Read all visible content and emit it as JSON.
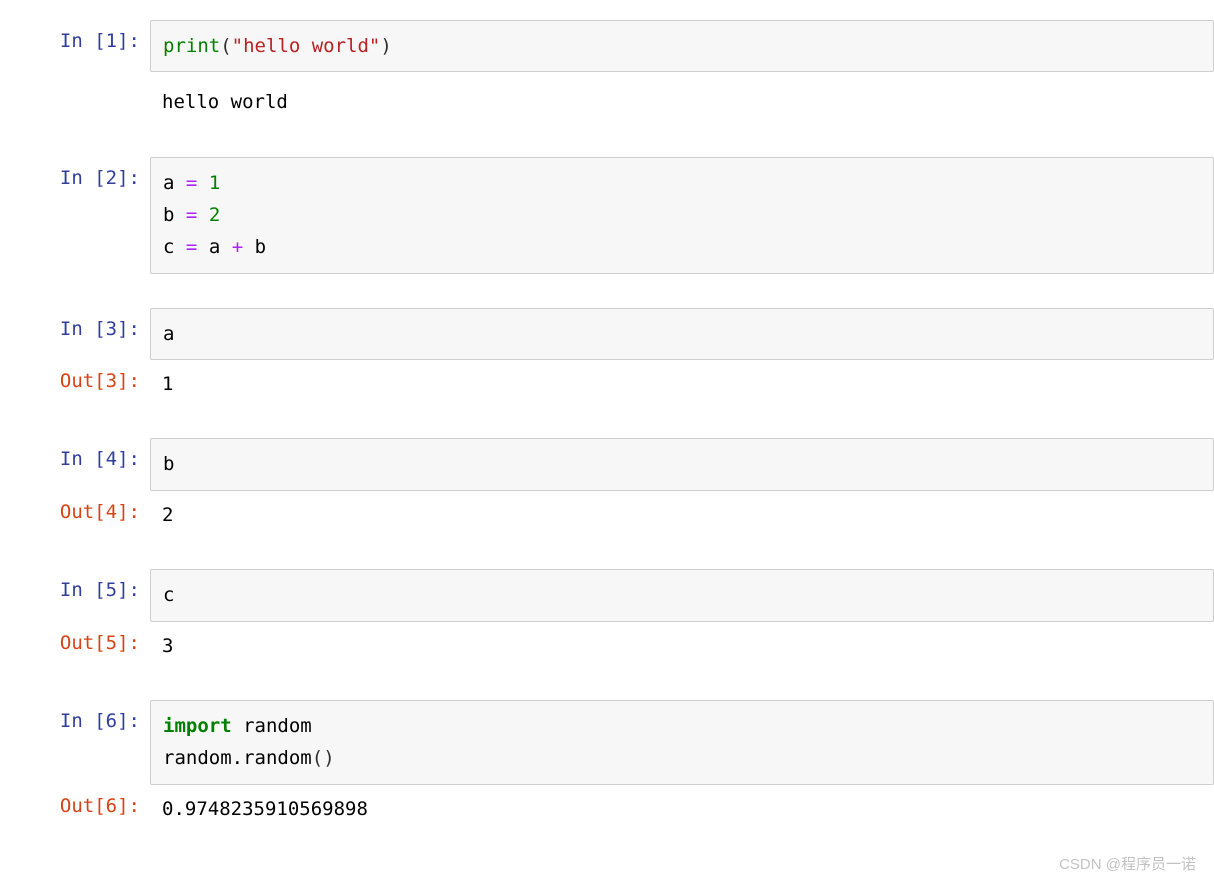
{
  "cells": [
    {
      "in_prompt": "In [1]:",
      "code_html": "<span class=\"tok-builtin\">print</span><span class=\"tok-paren\">(</span><span class=\"tok-string\">\"hello world\"</span><span class=\"tok-paren\">)</span>",
      "stream_output": "hello world"
    },
    {
      "in_prompt": "In [2]:",
      "code_html": "<span class=\"tok-name\">a</span> <span class=\"tok-op\">=</span> <span class=\"tok-num\">1</span>\n<span class=\"tok-name\">b</span> <span class=\"tok-op\">=</span> <span class=\"tok-num\">2</span>\n<span class=\"tok-name\">c</span> <span class=\"tok-op\">=</span> <span class=\"tok-name\">a</span> <span class=\"tok-op\">+</span> <span class=\"tok-name\">b</span>"
    },
    {
      "in_prompt": "In [3]:",
      "code_html": "<span class=\"tok-name\">a</span>",
      "out_prompt": "Out[3]:",
      "out_value": "1"
    },
    {
      "in_prompt": "In [4]:",
      "code_html": "<span class=\"tok-name\">b</span>",
      "out_prompt": "Out[4]:",
      "out_value": "2"
    },
    {
      "in_prompt": "In [5]:",
      "code_html": "<span class=\"tok-name\">c</span>",
      "out_prompt": "Out[5]:",
      "out_value": "3"
    },
    {
      "in_prompt": "In [6]:",
      "code_html": "<span class=\"tok-keyword\">import</span> <span class=\"tok-name\">random</span>\n<span class=\"tok-name\">random</span><span class=\"tok-dot\">.</span><span class=\"tok-name\">random</span><span class=\"tok-paren\">(</span><span class=\"tok-paren\">)</span>",
      "out_prompt": "Out[6]:",
      "out_value": "0.9748235910569898"
    }
  ],
  "watermark": "CSDN @程序员一诺"
}
